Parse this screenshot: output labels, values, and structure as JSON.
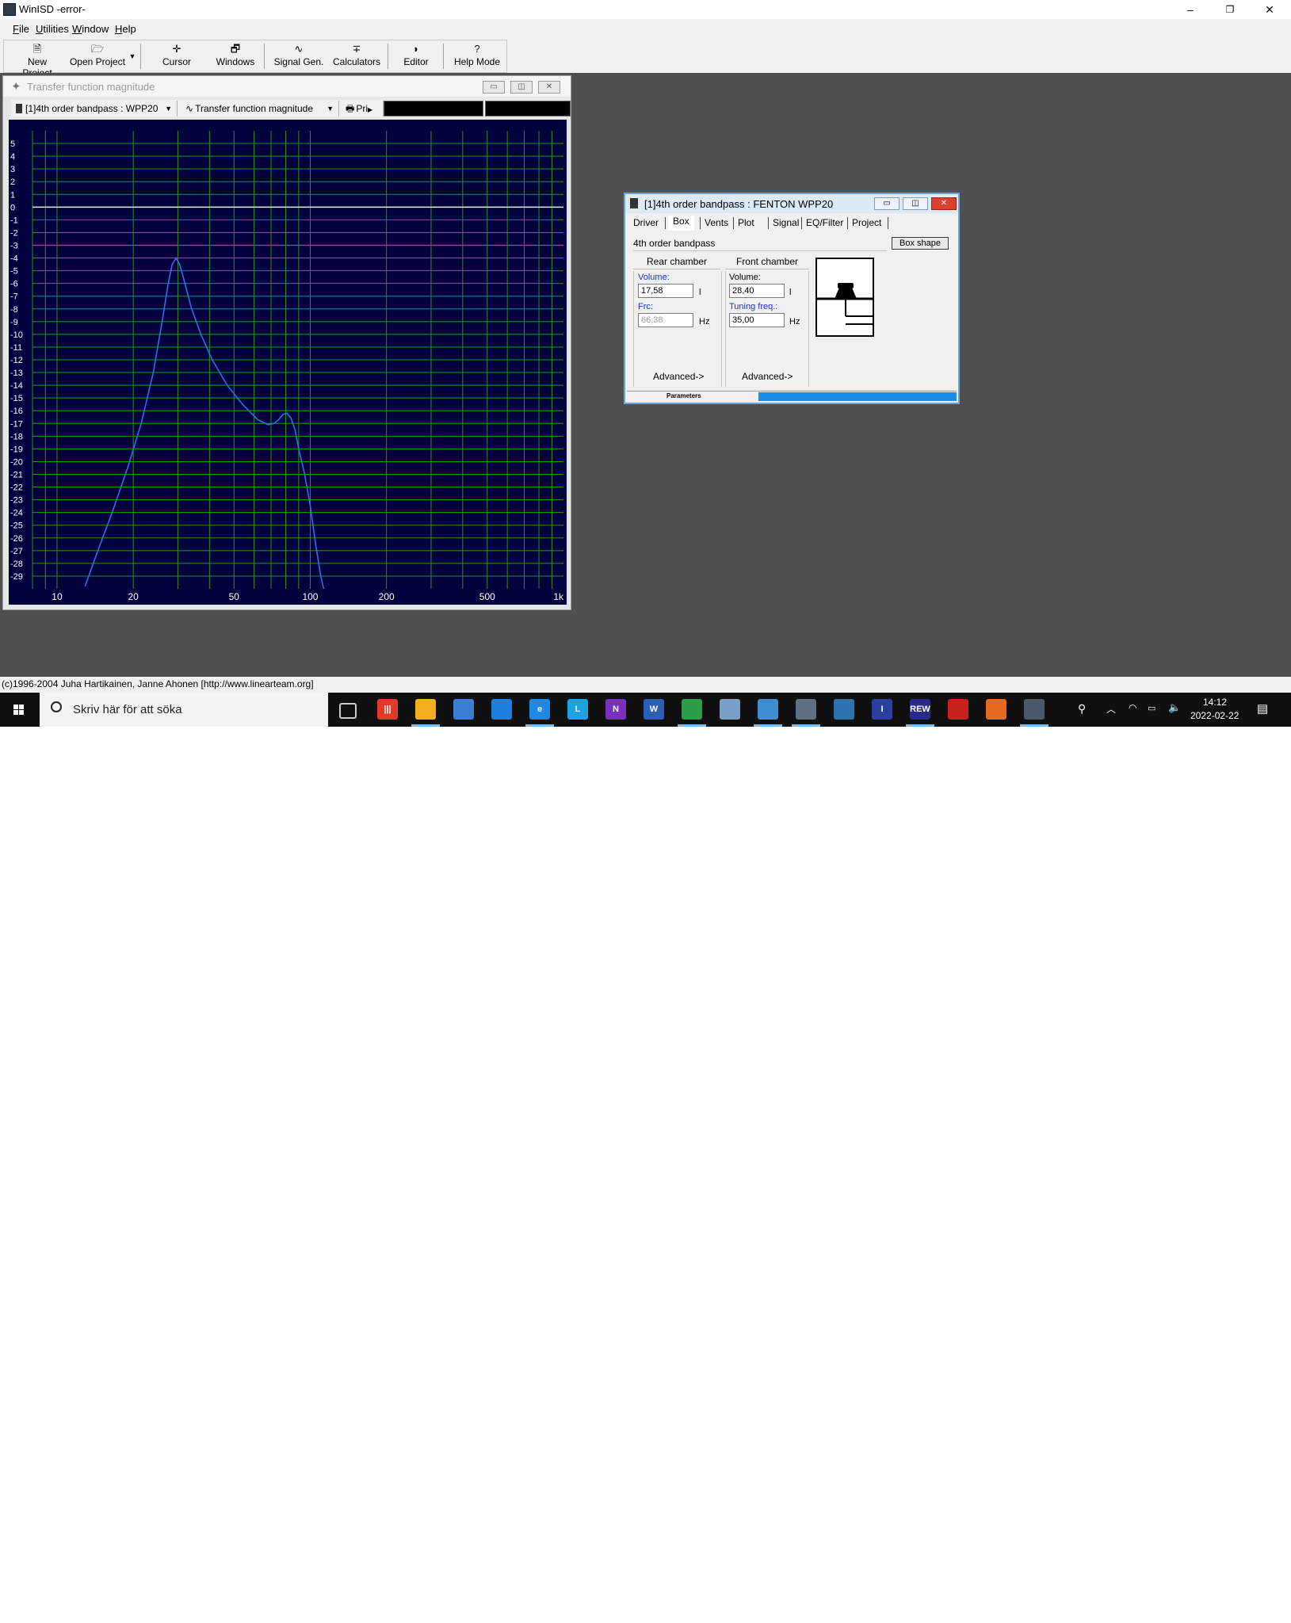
{
  "window": {
    "title": "WinISD -error-",
    "minimize": "–",
    "maximize": "❐",
    "close": "✕"
  },
  "menu": [
    "File",
    "Utilities",
    "Window",
    "Help"
  ],
  "toolbar": [
    {
      "label": "New Project",
      "icon": "🗎"
    },
    {
      "label": "Open Project",
      "icon": "🗁"
    },
    {
      "label": "Cursor",
      "icon": "✛"
    },
    {
      "label": "Windows",
      "icon": "🗗"
    },
    {
      "label": "Signal Gen.",
      "icon": "∿"
    },
    {
      "label": "Calculators",
      "icon": "∓"
    },
    {
      "label": "Editor",
      "icon": "◗"
    },
    {
      "label": "Help Mode",
      "icon": "?"
    }
  ],
  "plot_window": {
    "title": "Transfer function magnitude",
    "project_combo": "[1]4th order bandpass : WPP20",
    "graph_combo": "Transfer function magnitude",
    "print_label": "Pri"
  },
  "chart_data": {
    "type": "line",
    "xscale": "log",
    "xlim": [
      8,
      1000
    ],
    "ylim": [
      -30,
      6
    ],
    "x_ticks": [
      10,
      20,
      50,
      100,
      200,
      500,
      1000
    ],
    "x_tick_labels": [
      "10",
      "20",
      "50",
      "100",
      "200",
      "500",
      "1k"
    ],
    "y_ticks": [
      5,
      4,
      3,
      2,
      1,
      0,
      -1,
      -2,
      -3,
      -4,
      -5,
      -6,
      -7,
      -8,
      -9,
      -10,
      -11,
      -12,
      -13,
      -14,
      -15,
      -16,
      -17,
      -18,
      -19,
      -20,
      -21,
      -22,
      -23,
      -24,
      -25,
      -26,
      -27,
      -28,
      -29
    ],
    "reference_lines": [
      {
        "y": 0,
        "color": "#e8e8e8"
      },
      {
        "y": -3,
        "color": "#b0309a"
      }
    ],
    "grid": true,
    "background": "#00003c",
    "grid_color": "#1d9a1d",
    "series": [
      {
        "color": "#2f6fe8",
        "x": [
          12.9,
          14.5,
          16.5,
          19,
          21.5,
          24,
          26,
          27.5,
          28.5,
          29.5,
          30.5,
          32,
          34,
          37,
          41,
          47,
          54,
          62,
          68,
          72,
          75,
          78,
          81,
          84,
          87,
          90,
          95,
          100,
          105,
          110,
          113
        ],
        "y": [
          -29.8,
          -27,
          -24,
          -20.5,
          -17,
          -13,
          -9,
          -6,
          -4.5,
          -4,
          -4.5,
          -6,
          -8,
          -10,
          -12,
          -14,
          -15.5,
          -16.7,
          -17.1,
          -17,
          -16.7,
          -16.3,
          -16.2,
          -16.6,
          -17.5,
          -19,
          -21,
          -23.5,
          -26.5,
          -29,
          -30
        ]
      }
    ]
  },
  "box_window": {
    "title": "[1]4th order bandpass : FENTON WPP20",
    "tabs": [
      "Driver",
      "Box",
      "Vents",
      "Plot",
      "Signal",
      "EQ/Filter",
      "Project"
    ],
    "box_type": "4th order bandpass",
    "box_shape_button": "Box shape",
    "rear": {
      "header": "Rear chamber",
      "volume_label": "Volume:",
      "volume_value": "17,58",
      "volume_unit": "l",
      "fc_label": "Frc:",
      "fc_value": "66,38",
      "fc_unit": "Hz",
      "advanced": "Advanced->"
    },
    "front": {
      "header": "Front chamber",
      "volume_label": "Volume:",
      "volume_value": "28,40",
      "volume_unit": "l",
      "tuning_label": "Tuning freq.:",
      "tuning_value": "35,00",
      "tuning_unit": "Hz",
      "advanced": "Advanced->"
    },
    "status_label": "Parameters",
    "progress": 1.0
  },
  "status_text": "(c)1996-2004 Juha Hartikainen, Janne Ahonen [http://www.linearteam.org]",
  "taskbar": {
    "search_placeholder": "Skriv här för att söka",
    "time": "14:12",
    "date": "2022-02-22",
    "apps": [
      {
        "name": "task-view",
        "label": "",
        "color": "#101010"
      },
      {
        "name": "red-app",
        "label": "|||",
        "color": "#e03a2a"
      },
      {
        "name": "file-explorer",
        "label": "",
        "color": "#f2b01e"
      },
      {
        "name": "store",
        "label": "",
        "color": "#3b7ed6"
      },
      {
        "name": "mail",
        "label": "",
        "color": "#1f7fe0"
      },
      {
        "name": "edge",
        "label": "e",
        "color": "#1e88e5"
      },
      {
        "name": "l-app",
        "label": "L",
        "color": "#1aa3e0"
      },
      {
        "name": "onenote",
        "label": "N",
        "color": "#7b2fbe"
      },
      {
        "name": "word",
        "label": "W",
        "color": "#2b5fb6"
      },
      {
        "name": "chrome",
        "label": "",
        "color": "#2e9d4a"
      },
      {
        "name": "paint",
        "label": "",
        "color": "#7aa0c8"
      },
      {
        "name": "photos",
        "label": "",
        "color": "#3c8ed0"
      },
      {
        "name": "disc-app",
        "label": "",
        "color": "#607080"
      },
      {
        "name": "calculator",
        "label": "",
        "color": "#2c73b0"
      },
      {
        "name": "i-app",
        "label": "I",
        "color": "#2a3fa0"
      },
      {
        "name": "rew",
        "label": "REW",
        "color": "#2a2a8a"
      },
      {
        "name": "acrobat",
        "label": "",
        "color": "#c8201a"
      },
      {
        "name": "firefox",
        "label": "",
        "color": "#e66a1e"
      },
      {
        "name": "winisd",
        "label": "",
        "color": "#4a5868"
      }
    ]
  }
}
